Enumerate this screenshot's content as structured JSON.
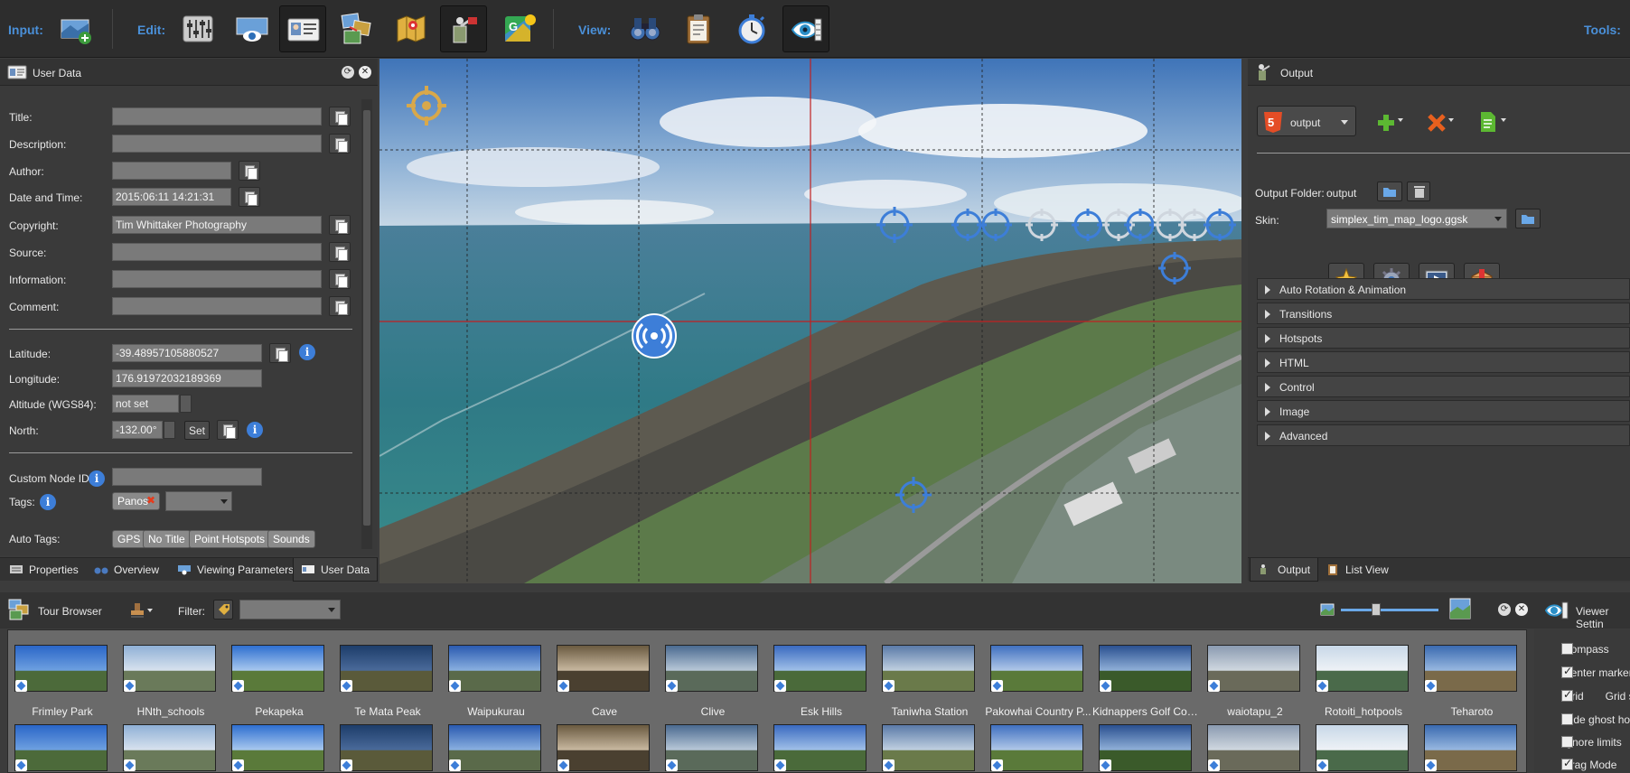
{
  "toolbar": {
    "input_label": "Input:",
    "edit_label": "Edit:",
    "view_label": "View:",
    "tools_label": "Tools:"
  },
  "user_data": {
    "title": "User Data",
    "fields": {
      "title_label": "Title:",
      "description_label": "Description:",
      "author_label": "Author:",
      "datetime_label": "Date and Time:",
      "datetime_value": "2015:06:11 14:21:31",
      "copyright_label": "Copyright:",
      "copyright_value": "Tim Whittaker Photography",
      "source_label": "Source:",
      "information_label": "Information:",
      "comment_label": "Comment:",
      "latitude_label": "Latitude:",
      "latitude_value": "-39.48957105880527",
      "longitude_label": "Longitude:",
      "longitude_value": "176.91972032189369",
      "altitude_label": "Altitude (WGS84):",
      "altitude_value": "not set",
      "north_label": "North:",
      "north_value": "-132.00°",
      "set_label": "Set",
      "custom_node_label": "Custom Node ID:",
      "tags_label": "Tags:",
      "tag_panos": "Panos",
      "auto_tags_label": "Auto Tags:",
      "auto_tags": [
        "GPS",
        "No Title",
        "Point Hotspots",
        "Sounds"
      ]
    }
  },
  "left_tabs": [
    "Properties",
    "Overview",
    "Viewing Parameters",
    "User Data"
  ],
  "output": {
    "title": "Output",
    "format": "output",
    "folder_label": "Output Folder:",
    "folder_value": "output",
    "skin_label": "Skin:",
    "skin_value": "simplex_tim_map_logo.ggsk",
    "sections": [
      "Auto Rotation & Animation",
      "Transitions",
      "Hotspots",
      "HTML",
      "Control",
      "Image",
      "Advanced"
    ]
  },
  "right_tabs": [
    "Output",
    "List View"
  ],
  "tour_browser": {
    "title": "Tour Browser",
    "filter_label": "Filter:",
    "row1": [
      "Frimley Park",
      "HNth_schools",
      "Pekapeka",
      "Te Mata Peak",
      "Waipukurau",
      "Cave",
      "Clive",
      "Esk Hills",
      "Taniwha Station",
      "Pakowhai Country P...",
      "Kidnappers Golf Cou...",
      "waiotapu_2",
      "Rotoiti_hotpools",
      "Teharoto"
    ]
  },
  "viewer_settings": {
    "title": "Viewer Settin",
    "items": [
      {
        "label": "Compass",
        "checked": false
      },
      {
        "label": "Center marker",
        "checked": true
      },
      {
        "label": "Grid",
        "checked": true,
        "extra": "Grid st"
      },
      {
        "label": "Hide ghost hots",
        "checked": false
      },
      {
        "label": "Ignore limits",
        "checked": false
      },
      {
        "label": "Drag Mode",
        "checked": true
      }
    ]
  },
  "colors": {
    "accent": "#4a90d9",
    "panel_bg": "#3a3a3a",
    "input_bg": "#7a7a7a",
    "hotspot": "#3d7ed8"
  }
}
